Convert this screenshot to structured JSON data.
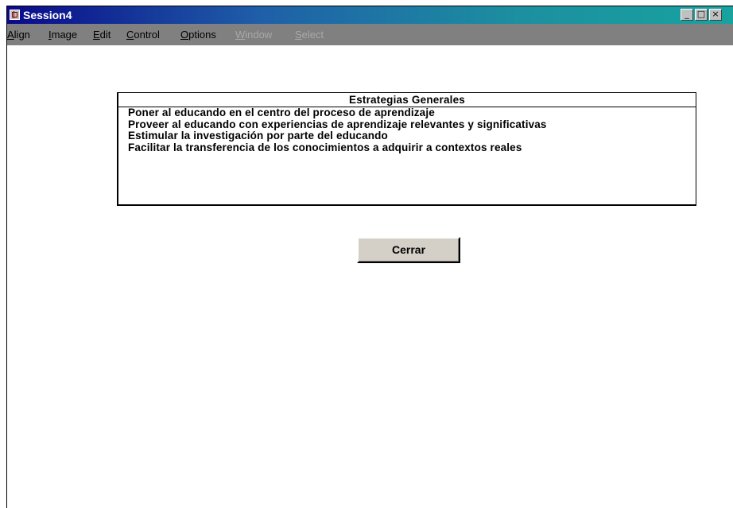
{
  "window": {
    "title": "Session4",
    "controls": {
      "minimize": "_",
      "maximize": "□",
      "close": "×"
    }
  },
  "menu": {
    "items": [
      {
        "label": "Align",
        "accel": "A",
        "rest": "lign",
        "enabled": true
      },
      {
        "label": "Image",
        "accel": "I",
        "rest": "mage",
        "enabled": true
      },
      {
        "label": "Edit",
        "accel": "E",
        "rest": "dit",
        "enabled": true
      },
      {
        "label": "Control",
        "accel": "C",
        "rest": "ontrol",
        "enabled": true
      },
      {
        "label": "Options",
        "accel": "O",
        "rest": "ptions",
        "enabled": true
      },
      {
        "label": "Window",
        "accel": "W",
        "rest": "indow",
        "enabled": false
      },
      {
        "label": "Select",
        "accel": "S",
        "rest": "elect",
        "enabled": false
      }
    ]
  },
  "panel": {
    "header": "Estrategias Generales",
    "items": [
      "Poner al educando en el centro del proceso de aprendizaje",
      "Proveer al educando con experiencias de aprendizaje relevantes y significativas",
      "Estimular la investigación por parte del educando",
      "Facilitar la transferencia de los conocimientos a adquirir a contextos reales"
    ]
  },
  "buttons": {
    "close_label": "Cerrar"
  }
}
